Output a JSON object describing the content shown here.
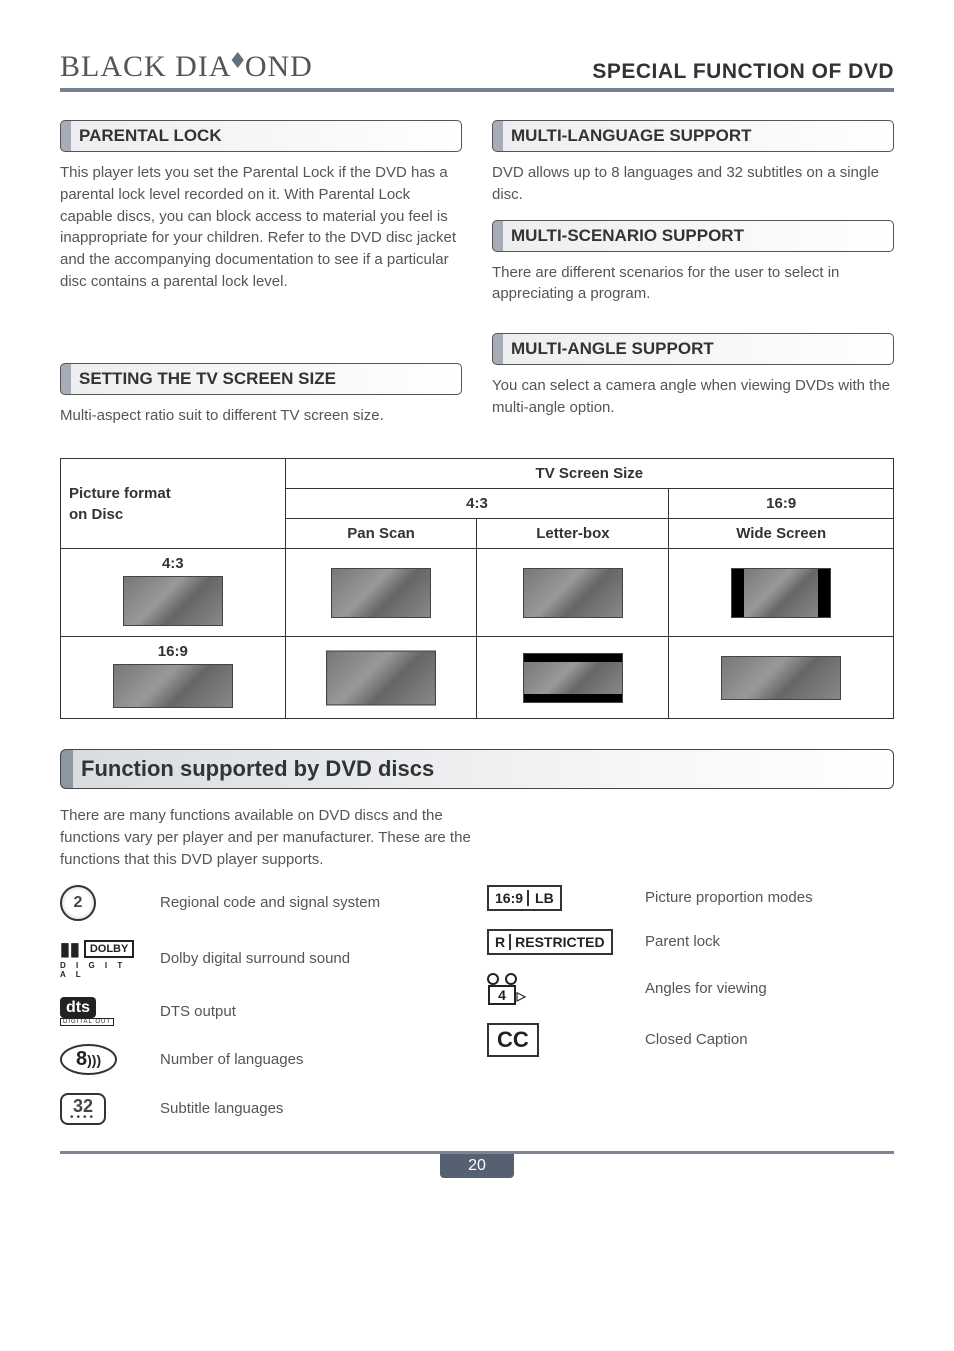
{
  "brand": {
    "part1": "BLACK DIA",
    "part2": "OND"
  },
  "pageTitle": "SPECIAL FUNCTION OF DVD",
  "sections": {
    "parental": {
      "title": "PARENTAL LOCK",
      "body": "This player lets you set the Parental Lock if the DVD has a parental lock level recorded on it. With Parental Lock capable discs, you can block access to material you feel is inappropriate for your children. Refer to the DVD disc jacket and the accompanying documentation to see if a particular disc contains a parental lock level."
    },
    "screen": {
      "title": "SETTING THE TV SCREEN SIZE",
      "body": "Multi-aspect ratio suit to different TV screen size."
    },
    "multilang": {
      "title": "MULTI-LANGUAGE SUPPORT",
      "body": "DVD allows up to 8 languages and 32 subtitles on a single disc."
    },
    "scenario": {
      "title": "MULTI-SCENARIO SUPPORT",
      "body": "There are different scenarios for the user to select in appreciating a program."
    },
    "angle": {
      "title": "MULTI-ANGLE SUPPORT",
      "body": "You can select a camera angle when viewing DVDs with the multi-angle option."
    }
  },
  "table": {
    "header": "TV Screen Size",
    "colA": "Picture format",
    "colB": "on Disc",
    "r43": "4:3",
    "r169": "16:9",
    "pan": "Pan Scan",
    "letter": "Letter-box",
    "wide": "Wide Screen",
    "row43": "4:3",
    "row169": "16:9"
  },
  "bigSection": {
    "title": "Function supported by DVD discs",
    "body": "There are many functions available on DVD discs and the functions vary per player and per manufacturer. These are the functions that this DVD player supports."
  },
  "features": {
    "region": {
      "icon": "2",
      "label": "Regional code and signal system"
    },
    "dolby": {
      "top": "DOLBY",
      "sub": "D I G I T A L",
      "label": "Dolby digital surround sound"
    },
    "dts": {
      "top": "dts",
      "sub": "DIGITAL OUT",
      "label": "DTS output"
    },
    "langs": {
      "num": "8",
      "label": "Number of languages"
    },
    "subs": {
      "num": "32",
      "label": "Subtitle languages"
    },
    "aspect": {
      "box1": "16:9",
      "box2": "LB",
      "label": "Picture proportion modes"
    },
    "restricted": {
      "r": "R",
      "text": "RESTRICTED",
      "label": "Parent lock"
    },
    "angles": {
      "num": "4",
      "label": "Angles for viewing"
    },
    "cc": {
      "text": "CC",
      "label": "Closed Caption"
    }
  },
  "pageNumber": "20"
}
